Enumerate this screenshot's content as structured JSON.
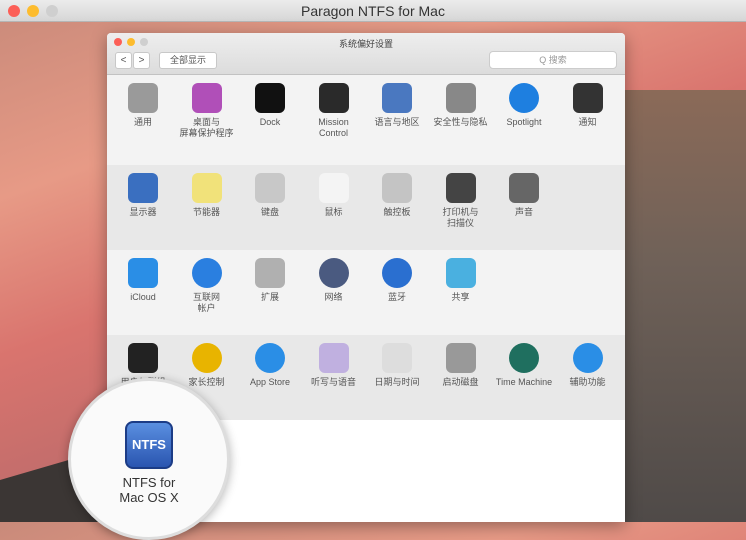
{
  "app_title": "Paragon NTFS for Mac",
  "prefs": {
    "title": "系统偏好设置",
    "back": "<",
    "forward": ">",
    "show_all": "全部显示",
    "search_placeholder": "Q 搜索",
    "rows": [
      [
        {
          "label": "通用",
          "icon": "gear-icon",
          "color": "#9a9a9a"
        },
        {
          "label": "桌面与\n屏幕保护程序",
          "icon": "desktop-icon",
          "color": "#b04fb8"
        },
        {
          "label": "Dock",
          "icon": "dock-icon",
          "color": "#111111"
        },
        {
          "label": "Mission\nControl",
          "icon": "mission-control-icon",
          "color": "#2a2a2a"
        },
        {
          "label": "语言与地区",
          "icon": "flag-icon",
          "color": "#4a78c0"
        },
        {
          "label": "安全性与隐私",
          "icon": "house-icon",
          "color": "#888888"
        },
        {
          "label": "Spotlight",
          "icon": "spotlight-icon",
          "color": "#1e7fe0"
        },
        {
          "label": "通知",
          "icon": "notifications-icon",
          "color": "#333333"
        }
      ],
      [
        {
          "label": "显示器",
          "icon": "display-icon",
          "color": "#3a6fc0"
        },
        {
          "label": "节能器",
          "icon": "bulb-icon",
          "color": "#f1e27a"
        },
        {
          "label": "键盘",
          "icon": "keyboard-icon",
          "color": "#c8c8c8"
        },
        {
          "label": "鼠标",
          "icon": "mouse-icon",
          "color": "#f4f4f4"
        },
        {
          "label": "触控板",
          "icon": "trackpad-icon",
          "color": "#c4c4c4"
        },
        {
          "label": "打印机与\n扫描仪",
          "icon": "printer-icon",
          "color": "#444444"
        },
        {
          "label": "声音",
          "icon": "speaker-icon",
          "color": "#666666"
        }
      ],
      [
        {
          "label": "iCloud",
          "icon": "icloud-icon",
          "color": "#2a8ee6"
        },
        {
          "label": "互联网\n帐户",
          "icon": "at-icon",
          "color": "#2a7fe0"
        },
        {
          "label": "扩展",
          "icon": "extensions-icon",
          "color": "#b0b0b0"
        },
        {
          "label": "网络",
          "icon": "globe-icon",
          "color": "#4a5a80"
        },
        {
          "label": "蓝牙",
          "icon": "bluetooth-icon",
          "color": "#2a6fd0"
        },
        {
          "label": "共享",
          "icon": "sharing-folder-icon",
          "color": "#4ab0e0"
        }
      ],
      [
        {
          "label": "用户与群组",
          "icon": "users-icon",
          "color": "#222222"
        },
        {
          "label": "家长控制",
          "icon": "parental-controls-icon",
          "color": "#e8b400"
        },
        {
          "label": "App Store",
          "icon": "app-store-icon",
          "color": "#2a8ee6"
        },
        {
          "label": "听写与语音",
          "icon": "microphone-icon",
          "color": "#c0b0e0"
        },
        {
          "label": "日期与时间",
          "icon": "clock-icon",
          "color": "#dddddd"
        },
        {
          "label": "启动磁盘",
          "icon": "disk-icon",
          "color": "#999999"
        },
        {
          "label": "Time Machine",
          "icon": "time-machine-icon",
          "color": "#1f6f5f"
        },
        {
          "label": "辅助功能",
          "icon": "accessibility-icon",
          "color": "#2a8ee6"
        }
      ]
    ]
  },
  "magnifier": {
    "icon_text": "NTFS",
    "label": "NTFS for\nMac OS X"
  }
}
